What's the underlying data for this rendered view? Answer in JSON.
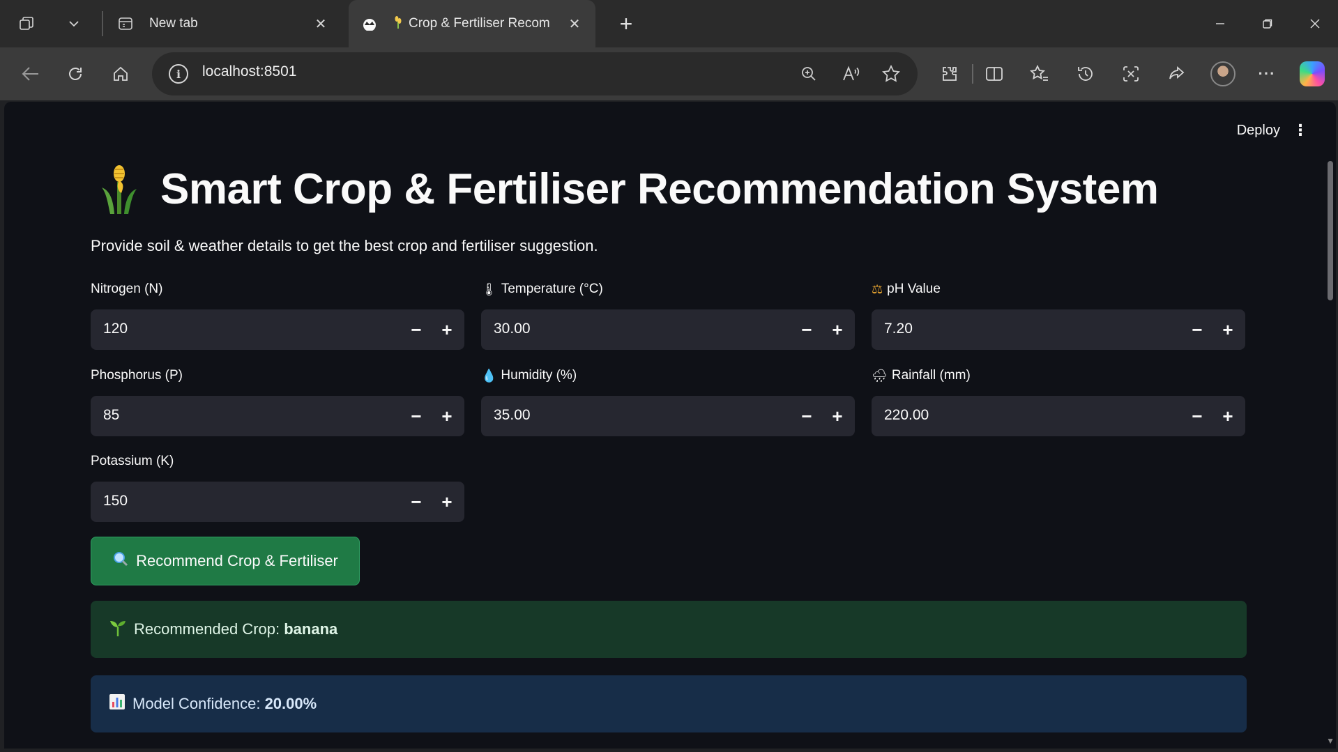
{
  "browser": {
    "tabs": [
      {
        "title": "New tab"
      },
      {
        "title": "Crop & Fertiliser Recom"
      }
    ],
    "url": "localhost:8501"
  },
  "app": {
    "deploy_label": "Deploy",
    "title": "Smart Crop & Fertiliser Recommendation System",
    "subtitle": "Provide soil & weather details to get the best crop and fertiliser suggestion.",
    "fields": [
      {
        "label": "Nitrogen (N)",
        "emoji": "",
        "value": "120"
      },
      {
        "label": "Temperature (°C)",
        "emoji": "🌡",
        "value": "30.00"
      },
      {
        "label": "pH Value",
        "emoji": "⚖",
        "value": "7.20"
      },
      {
        "label": "Phosphorus (P)",
        "emoji": "",
        "value": "85"
      },
      {
        "label": "Humidity (%)",
        "emoji": "💧",
        "value": "35.00"
      },
      {
        "label": "Rainfall (mm)",
        "emoji": "🌧",
        "value": "220.00"
      },
      {
        "label": "Potassium (K)",
        "emoji": "",
        "value": "150"
      }
    ],
    "button_label": "Recommend Crop & Fertiliser",
    "crop_result": {
      "prefix": "Recommended Crop: ",
      "value": "banana"
    },
    "confidence_result": {
      "prefix": "Model Confidence: ",
      "value": "20.00%"
    }
  }
}
